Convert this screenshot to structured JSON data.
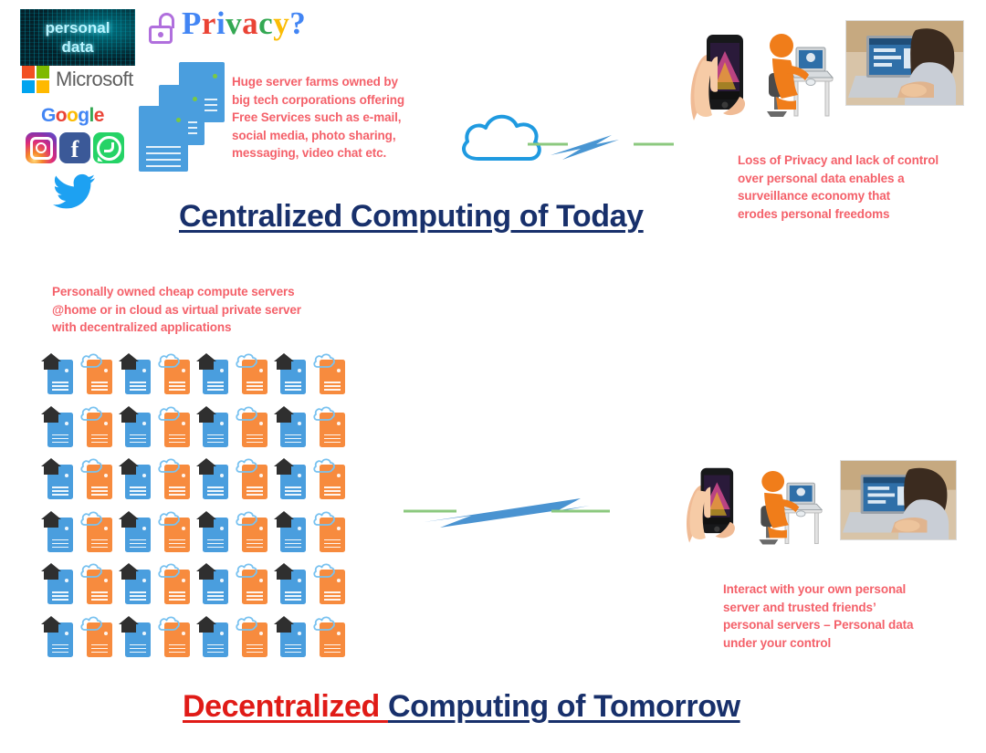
{
  "top_section": {
    "banner": {
      "line1": "personal",
      "line2": "data",
      "name": "personal-data-banner"
    },
    "brands": [
      {
        "name": "microsoft",
        "label": "Microsoft"
      },
      {
        "name": "google",
        "label": "Google"
      },
      {
        "name": "instagram",
        "label": "Instagram"
      },
      {
        "name": "facebook",
        "label": "f"
      },
      {
        "name": "whatsapp",
        "label": "WhatsApp"
      },
      {
        "name": "twitter",
        "label": "Twitter"
      }
    ],
    "privacy_heading": "Privacy?",
    "privacy_letters": [
      {
        "ch": "P",
        "color": "#4285f4"
      },
      {
        "ch": "r",
        "color": "#ea4335"
      },
      {
        "ch": "i",
        "color": "#4285f4"
      },
      {
        "ch": "v",
        "color": "#34a853"
      },
      {
        "ch": "a",
        "color": "#ea4335"
      },
      {
        "ch": "c",
        "color": "#34a853"
      },
      {
        "ch": "y",
        "color": "#fbbc05"
      },
      {
        "ch": "?",
        "color": "#4285f4"
      }
    ],
    "server_caption": "Huge server farms owned by\nbig tech corporations offering\nFree Services such as e-mail,\nsocial media, photo sharing,\nmessaging, video chat etc.",
    "privacy_loss_caption": "Loss of Privacy and lack of control\nover personal data enables  a\nsurveillance economy that\nerodes personal freedoms",
    "title": "Centralized Computing of Today"
  },
  "bottom_section": {
    "servers_caption": "Personally owned cheap compute servers\n@home or in cloud as virtual private server\nwith decentralized applications",
    "interact_caption": "Interact with your own personal\nserver and trusted friends’\npersonal servers – Personal data\nunder your control",
    "title_part1": "Decentralized ",
    "title_part2": "Computing of Tomorrow",
    "grid": {
      "rows": 6,
      "cols": 8,
      "node_types": [
        "home-server",
        "cloud-server"
      ],
      "home_color": "#4a9ede",
      "cloud_color": "#f78b3e"
    }
  },
  "icons": {
    "cloud": "cloud-icon",
    "lightning": "lightning-bolt-icon",
    "lock": "open-padlock-icon",
    "home": "home-icon",
    "server": "server-icon"
  },
  "photos": {
    "phone": "hand-holding-smartphone-photo",
    "desk": "orange-figure-at-desk-illustration",
    "laptop": "man-using-laptop-photo"
  },
  "colors": {
    "navy": "#18306b",
    "red_title": "#e01b17",
    "red_text": "#f4616a",
    "blue": "#4a9ede",
    "orange": "#f78b3e",
    "green": "#7ac943",
    "purple": "#b06fdd"
  }
}
